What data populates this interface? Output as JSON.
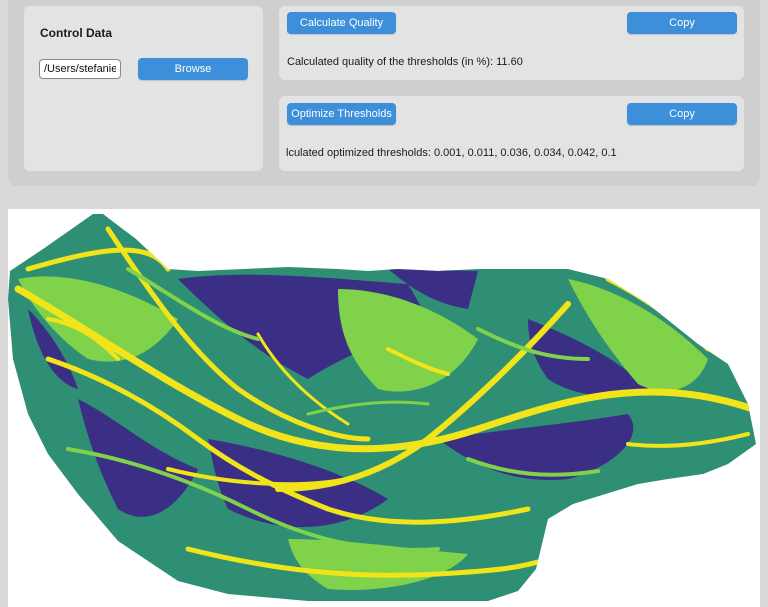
{
  "control": {
    "title": "Control Data",
    "path_value": "/Users/stefanie",
    "browse_label": "Browse"
  },
  "quality": {
    "button_label": "Calculate Quality",
    "copy_label": "Copy",
    "result_text": "Calculated quality of the thresholds (in %): 11.60"
  },
  "optimize": {
    "button_label": "Optimize Thresholds",
    "copy_label": "Copy",
    "result_text": "lculated optimized thresholds: 0.001, 0.011, 0.036, 0.034, 0.042, 0.1"
  },
  "map": {
    "colors": {
      "dark": "#3b2f85",
      "mid": "#2e8f74",
      "green": "#7fd24a",
      "yellow": "#f2e41a"
    }
  }
}
